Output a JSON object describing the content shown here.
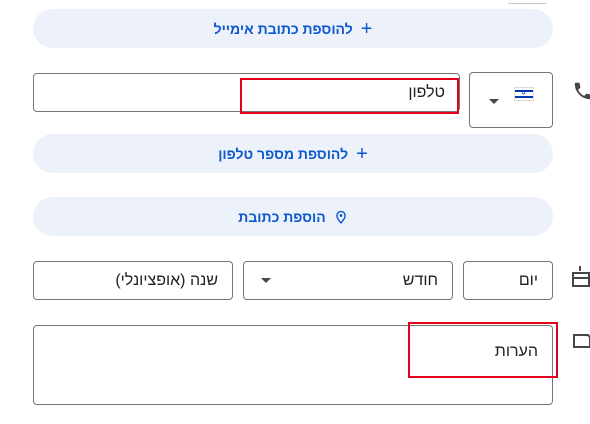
{
  "email": {
    "add_label": "להוספת כתובת אימייל",
    "icon": "plus-icon"
  },
  "phone": {
    "placeholder": "טלפון",
    "country_flag": "israel-flag-icon",
    "add_label": "להוספת מספר טלפון",
    "icon": "plus-icon"
  },
  "address": {
    "add_label": "הוספת כתובת",
    "icon": "location-pin-icon"
  },
  "birthday": {
    "day_placeholder": "יום",
    "month_placeholder": "חודש",
    "year_placeholder": "שנה (אופציונלי)"
  },
  "notes": {
    "placeholder": "הערות"
  },
  "colors": {
    "accent": "#0b57d0",
    "pill_bg": "#edf2fa",
    "highlight": "#e0001b"
  }
}
